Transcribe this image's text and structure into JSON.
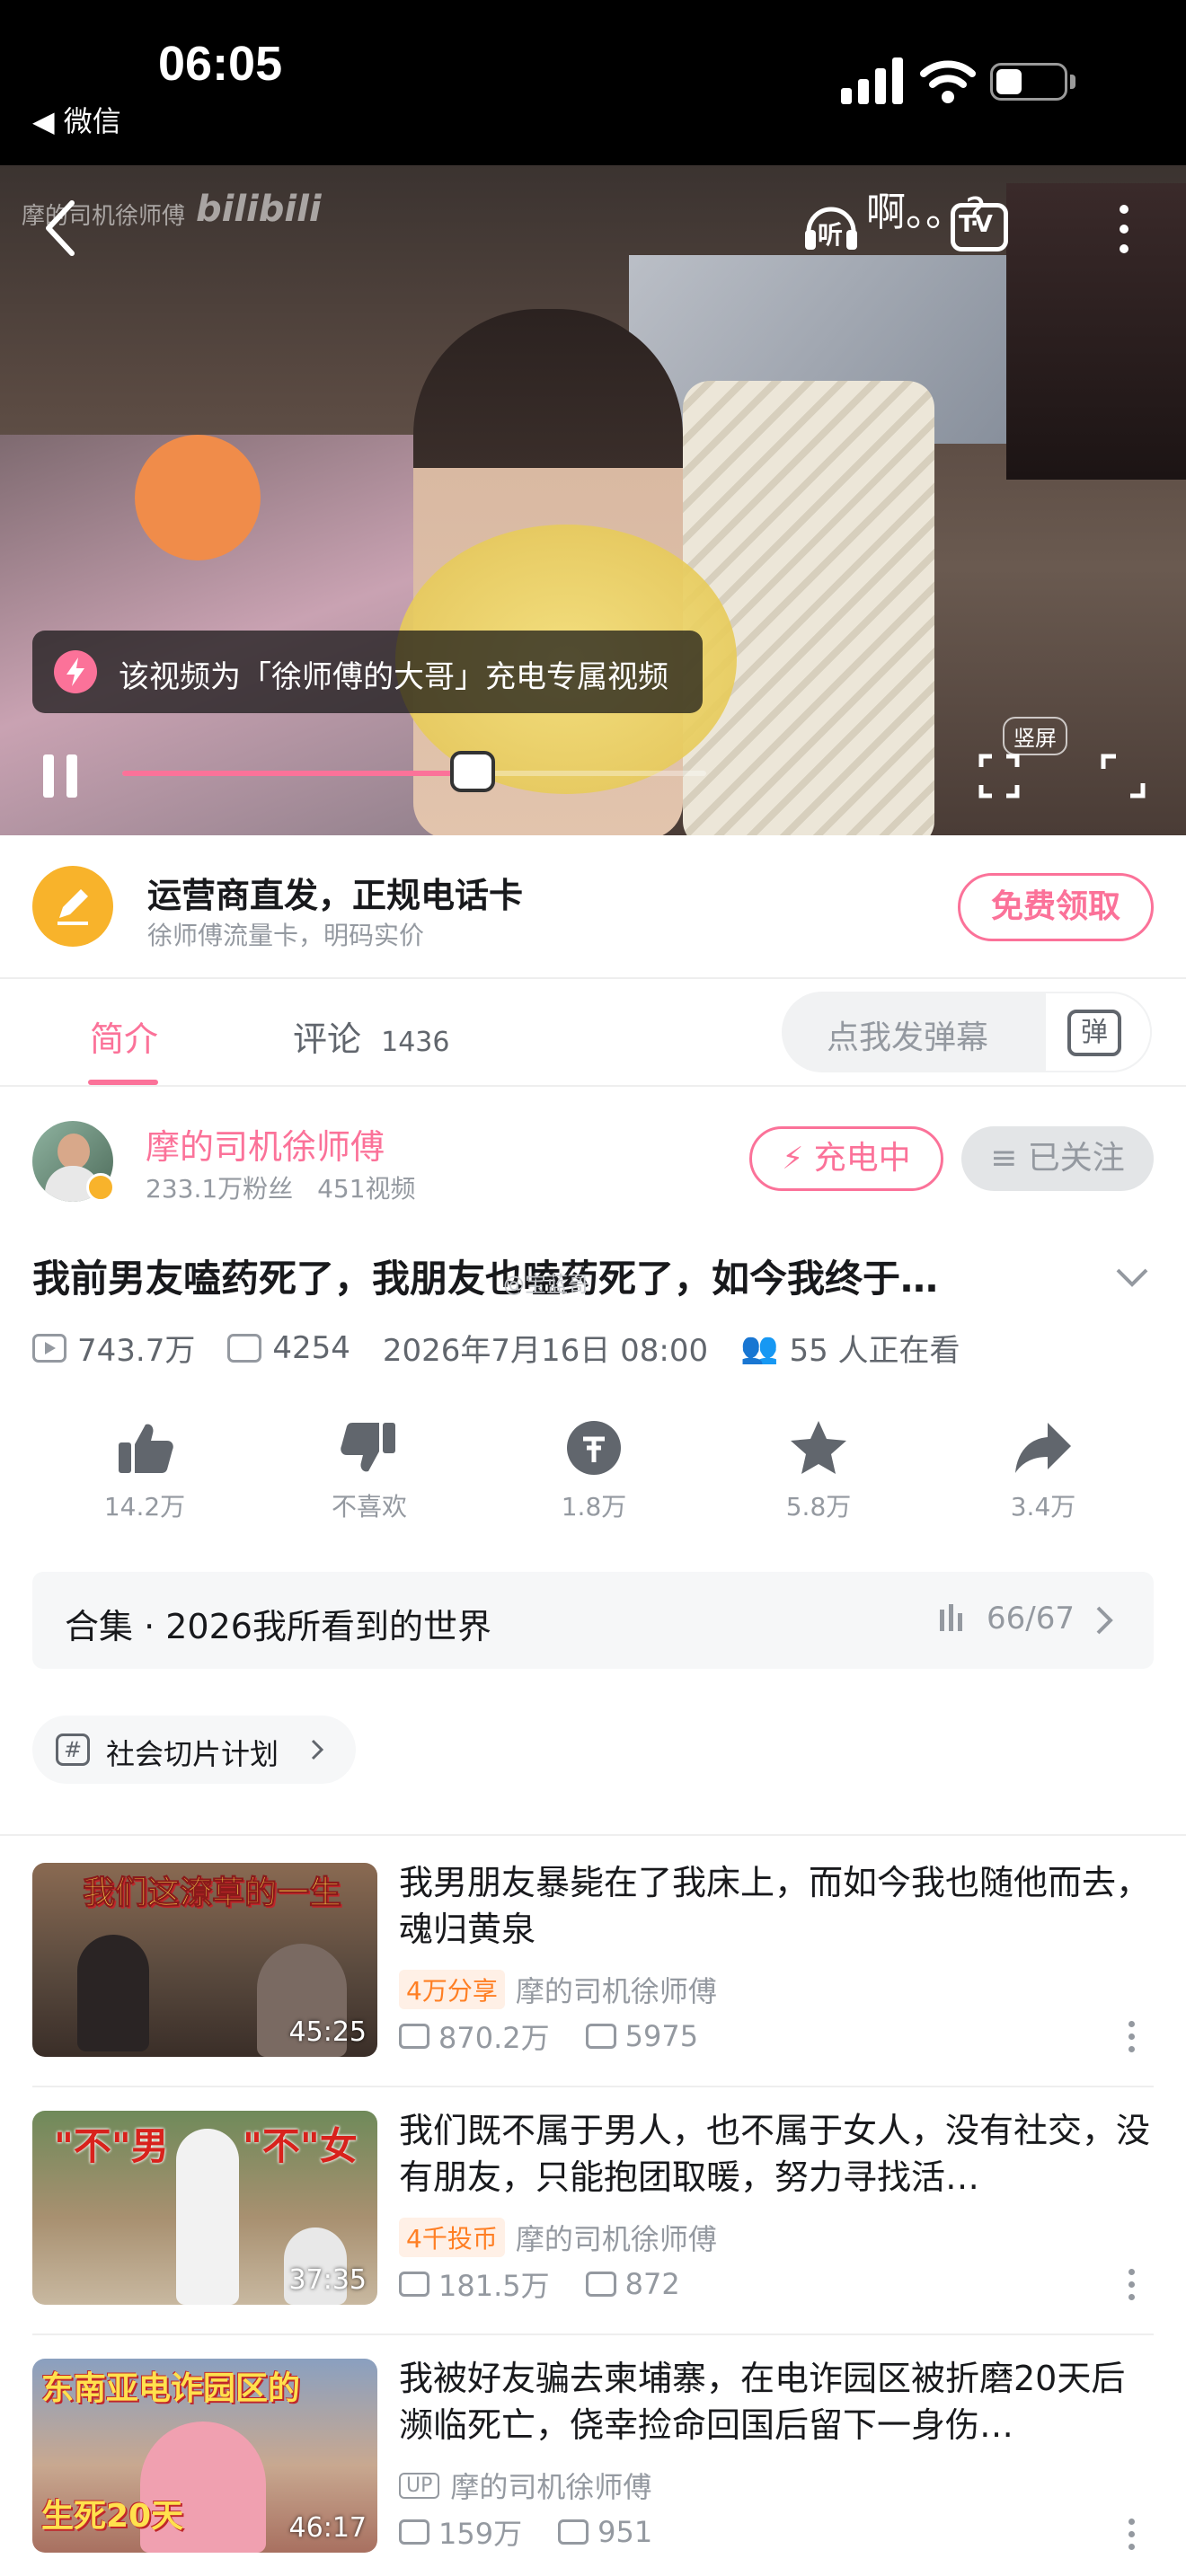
{
  "status_bar": {
    "time": "06:05",
    "back_app": "◀ 微信"
  },
  "player": {
    "watermark": "摩的司机徐师傅",
    "brand": "bilibili",
    "overlay_text": "啊。。?",
    "charge_notice": "该视频为「徐师傅的大哥」充电专属视频",
    "portrait_label": "竖屏",
    "progress_fraction": 0.6,
    "tv_label": "TV",
    "listen_label": "听"
  },
  "ad": {
    "title": "运营商直发，正规电话卡",
    "subtitle": "徐师傅流量卡，明码实价",
    "button": "免费领取"
  },
  "tabs": {
    "intro": "简介",
    "comments": "评论",
    "comments_count": "1436",
    "danmaku_placeholder": "点我发弹幕",
    "danmaku_icon_label": "弹"
  },
  "uploader": {
    "name": "摩的司机徐师傅",
    "fans": "233.1万粉丝",
    "videos": "451视频",
    "charge_button": "充电中",
    "follow_button": "已关注"
  },
  "video": {
    "title": "我前男友嗑药死了，我朋友也嗑药死了，如今我终于…",
    "weibo_watermark": "@宝蓝哥",
    "views": "743.7万",
    "danmaku": "4254",
    "date": "2026年7月16日 08:00",
    "watching": "55 人正在看"
  },
  "actions": [
    {
      "icon": "thumbs-up-icon",
      "label": "14.2万"
    },
    {
      "icon": "thumbs-down-icon",
      "label": "不喜欢"
    },
    {
      "icon": "coin-icon",
      "label": "1.8万"
    },
    {
      "icon": "star-icon",
      "label": "5.8万"
    },
    {
      "icon": "share-icon",
      "label": "3.4万"
    }
  ],
  "collection": {
    "label": "合集 · 2026我所看到的世界",
    "progress": "66/67"
  },
  "topic": {
    "label": "社会切片计划"
  },
  "related": [
    {
      "title": "我男朋友暴毙在了我床上，而如今我也随他而去，魂归黄泉",
      "thumb_text": "我们这潦草的一生",
      "duration": "45:25",
      "badge": "4万分享",
      "author": "摩的司机徐师傅",
      "views": "870.2万",
      "danmaku": "5975"
    },
    {
      "title": "我们既不属于男人，也不属于女人，没有社交，没有朋友，只能抱团取暖，努力寻找活…",
      "thumb_text_left": "\"不\"男",
      "thumb_text_right": "\"不\"女",
      "duration": "37:35",
      "badge": "4千投币",
      "author": "摩的司机徐师傅",
      "views": "181.5万",
      "danmaku": "872"
    },
    {
      "title": "我被好友骗去柬埔寨，在电诈园区被折磨20天后濒临死亡，侥幸捡命回国后留下一身伤…",
      "thumb_text": "东南亚电诈园区的",
      "thumb_text2": "生死20天",
      "duration": "46:17",
      "badge": "UP",
      "author": "摩的司机徐师傅",
      "views": "159万",
      "danmaku": "951"
    }
  ],
  "colors": {
    "pink": "#fb7299",
    "gray_text": "#9499a0",
    "orange": "#ff7f24",
    "ad_icon_bg": "#f8b32b"
  }
}
